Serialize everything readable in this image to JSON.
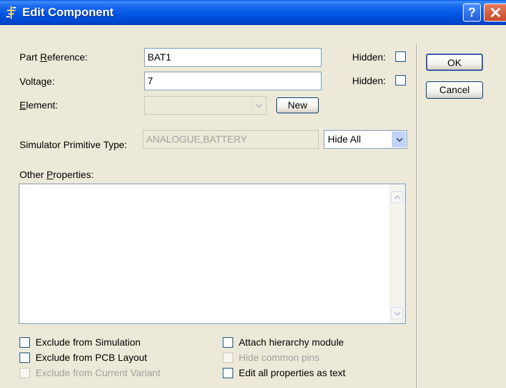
{
  "window": {
    "title": "Edit Component",
    "help_button": "?",
    "close_button": "X"
  },
  "fields": {
    "part_reference": {
      "label_pre": "Part ",
      "label_u": "R",
      "label_post": "eference:",
      "value": "BAT1",
      "hidden_label": "Hidden:"
    },
    "voltage": {
      "label": "Voltage:",
      "value": "7",
      "hidden_label": "Hidden:"
    },
    "element": {
      "label_u": "E",
      "label_post": "lement:",
      "value": "",
      "new_button": "New"
    },
    "primitive": {
      "label": "Simulator Primitive Type:",
      "value": "ANALOGUE,BATTERY"
    },
    "hide_select": {
      "value": "Hide All"
    },
    "other_properties": {
      "label_pre": "Other ",
      "label_u": "P",
      "label_post": "roperties:",
      "value": ""
    }
  },
  "buttons": {
    "ok": "OK",
    "cancel": "Cancel"
  },
  "options": {
    "exclude_simulation": "Exclude from Simulation",
    "exclude_pcb": "Exclude from PCB Layout",
    "exclude_variant": "Exclude from Current Variant",
    "attach_hierarchy": "Attach hierarchy module",
    "hide_common_pins": "Hide common pins",
    "edit_as_text": "Edit all properties as text"
  },
  "colors": {
    "titlebar": "#0055e5",
    "dialog_bg": "#ece9d8",
    "input_border": "#7f9db9",
    "disabled_text": "#a0a0a0"
  }
}
